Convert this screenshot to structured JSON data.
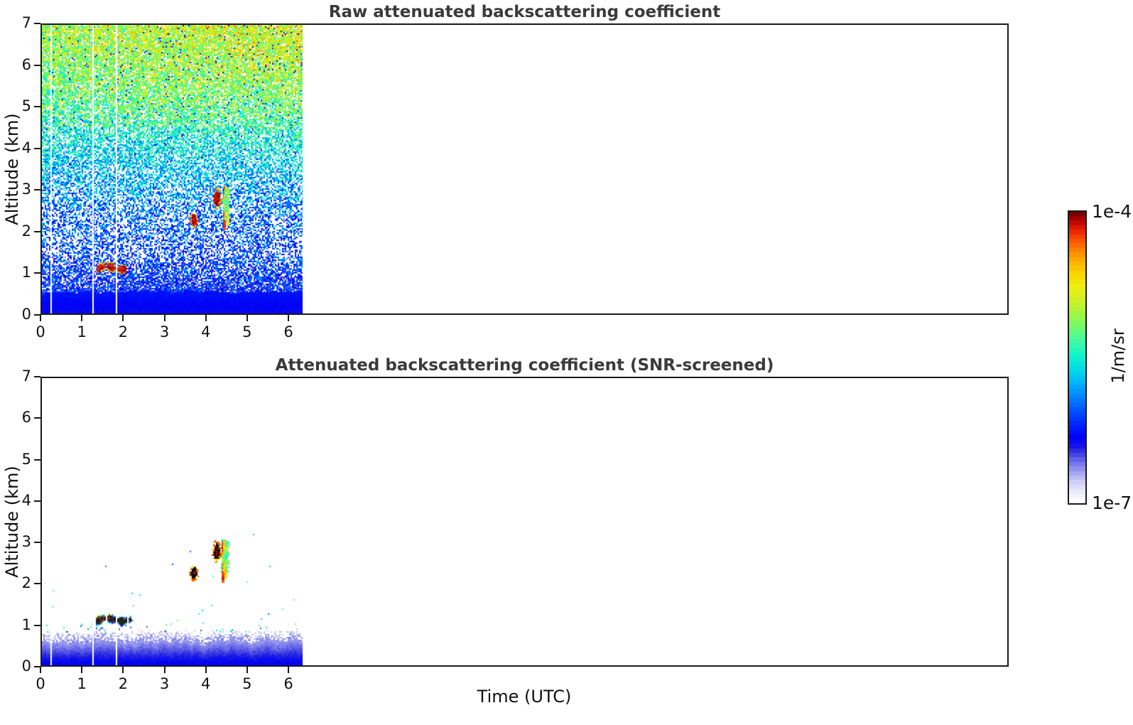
{
  "figure": {
    "xlabel": "Time (UTC)",
    "panels": [
      {
        "title": "Raw attenuated backscattering coefficient",
        "ylabel": "Altitude (km)"
      },
      {
        "title": "Attenuated backscattering coefficient (SNR-screened)",
        "ylabel": "Altitude (km)"
      }
    ],
    "colorbar": {
      "top_label": "1e-4",
      "bottom_label": "1e-7",
      "unit": "1/m/sr"
    }
  },
  "chart_data": {
    "type": "heatmap",
    "x_axis": {
      "label": "Time (UTC)",
      "ticks": [
        0,
        1,
        2,
        3,
        4,
        5,
        6
      ],
      "axis_range": [
        0,
        23.4
      ],
      "data_extent": [
        0,
        6.3
      ]
    },
    "y_axis": {
      "label": "Altitude (km)",
      "ticks": [
        0,
        1,
        2,
        3,
        4,
        5,
        6,
        7
      ],
      "range": [
        0,
        7
      ]
    },
    "colorbar": {
      "scale": "log",
      "vmin": 1e-07,
      "vmax": 0.0001,
      "unit": "1/m/sr",
      "top_label": "1e-4",
      "bottom_label": "1e-7",
      "colormap": "jet-like, fading to white at low end",
      "discrete_steps": 64
    },
    "data_gaps_utc": [
      0.2,
      1.22,
      1.78
    ],
    "panels": [
      {
        "title": "Raw attenuated backscattering coefficient",
        "description": "Dense random noise speckle over whole profile; solid blue surface layer; saturated cloud returns",
        "noise_profile": [
          {
            "alt_km": 0.3,
            "fill_fraction": 1.0,
            "mean_level": 0.22
          },
          {
            "alt_km": 0.75,
            "fill_fraction": 0.8,
            "mean_level": 0.26
          },
          {
            "alt_km": 1.5,
            "fill_fraction": 0.5,
            "mean_level": 0.29
          },
          {
            "alt_km": 2.5,
            "fill_fraction": 0.53,
            "mean_level": 0.34
          },
          {
            "alt_km": 3.5,
            "fill_fraction": 0.62,
            "mean_level": 0.43
          },
          {
            "alt_km": 4.5,
            "fill_fraction": 0.72,
            "mean_level": 0.5
          },
          {
            "alt_km": 5.5,
            "fill_fraction": 0.82,
            "mean_level": 0.56
          },
          {
            "alt_km": 7.0,
            "fill_fraction": 0.9,
            "mean_level": 0.625
          }
        ],
        "surface_layer": {
          "top_km": 0.52,
          "mean_level": 0.225
        },
        "features": [
          {
            "name": "cloud-layer",
            "style": "streak",
            "time_utc": [
              1.33,
              2.06
            ],
            "altitude_km": [
              1.02,
              1.19
            ],
            "core_level": 0.97,
            "saturated": false
          },
          {
            "name": "cloud-blob-1",
            "style": "blob",
            "time_utc": [
              3.56,
              3.77
            ],
            "altitude_km": [
              2.08,
              2.46
            ],
            "core_level": 0.97,
            "saturated": false
          },
          {
            "name": "cloud-blob-2",
            "style": "blob",
            "time_utc": [
              4.11,
              4.33
            ],
            "altitude_km": [
              2.53,
              3.06
            ],
            "core_level": 0.97,
            "saturated": false
          },
          {
            "name": "virga-streaks",
            "style": "virga",
            "time_utc": [
              4.34,
              4.52
            ],
            "altitude_km": [
              2.0,
              3.1
            ],
            "core_level": 0.74,
            "saturated": false
          }
        ]
      },
      {
        "title": "Attenuated backscattering coefficient (SNR-screened)",
        "description": "Noise removed: white background, blue boundary layer with fuzzy top, saturated (black-core) clouds, sparse residual pixels",
        "boundary_layer": {
          "top_km_min": 0.45,
          "top_km_max": 0.72,
          "fuzz_km": 0.28,
          "mean_level": 0.2
        },
        "sparse_pixel_count": 55,
        "features": [
          {
            "name": "cloud-layer",
            "style": "streak",
            "time_utc": [
              1.3,
              2.13
            ],
            "altitude_km": [
              1.0,
              1.22
            ],
            "core_level": 1.0,
            "saturated": true
          },
          {
            "name": "cloud-blob-1",
            "style": "blob",
            "time_utc": [
              3.56,
              3.77
            ],
            "altitude_km": [
              2.08,
              2.46
            ],
            "core_level": 1.0,
            "saturated": true
          },
          {
            "name": "cloud-blob-2",
            "style": "blob",
            "time_utc": [
              4.11,
              4.33
            ],
            "altitude_km": [
              2.53,
              3.06
            ],
            "core_level": 1.0,
            "saturated": true
          },
          {
            "name": "virga-streaks",
            "style": "virga",
            "time_utc": [
              4.3,
              4.52
            ],
            "altitude_km": [
              2.0,
              3.08
            ],
            "core_level": 0.8,
            "saturated": false
          }
        ]
      }
    ]
  }
}
